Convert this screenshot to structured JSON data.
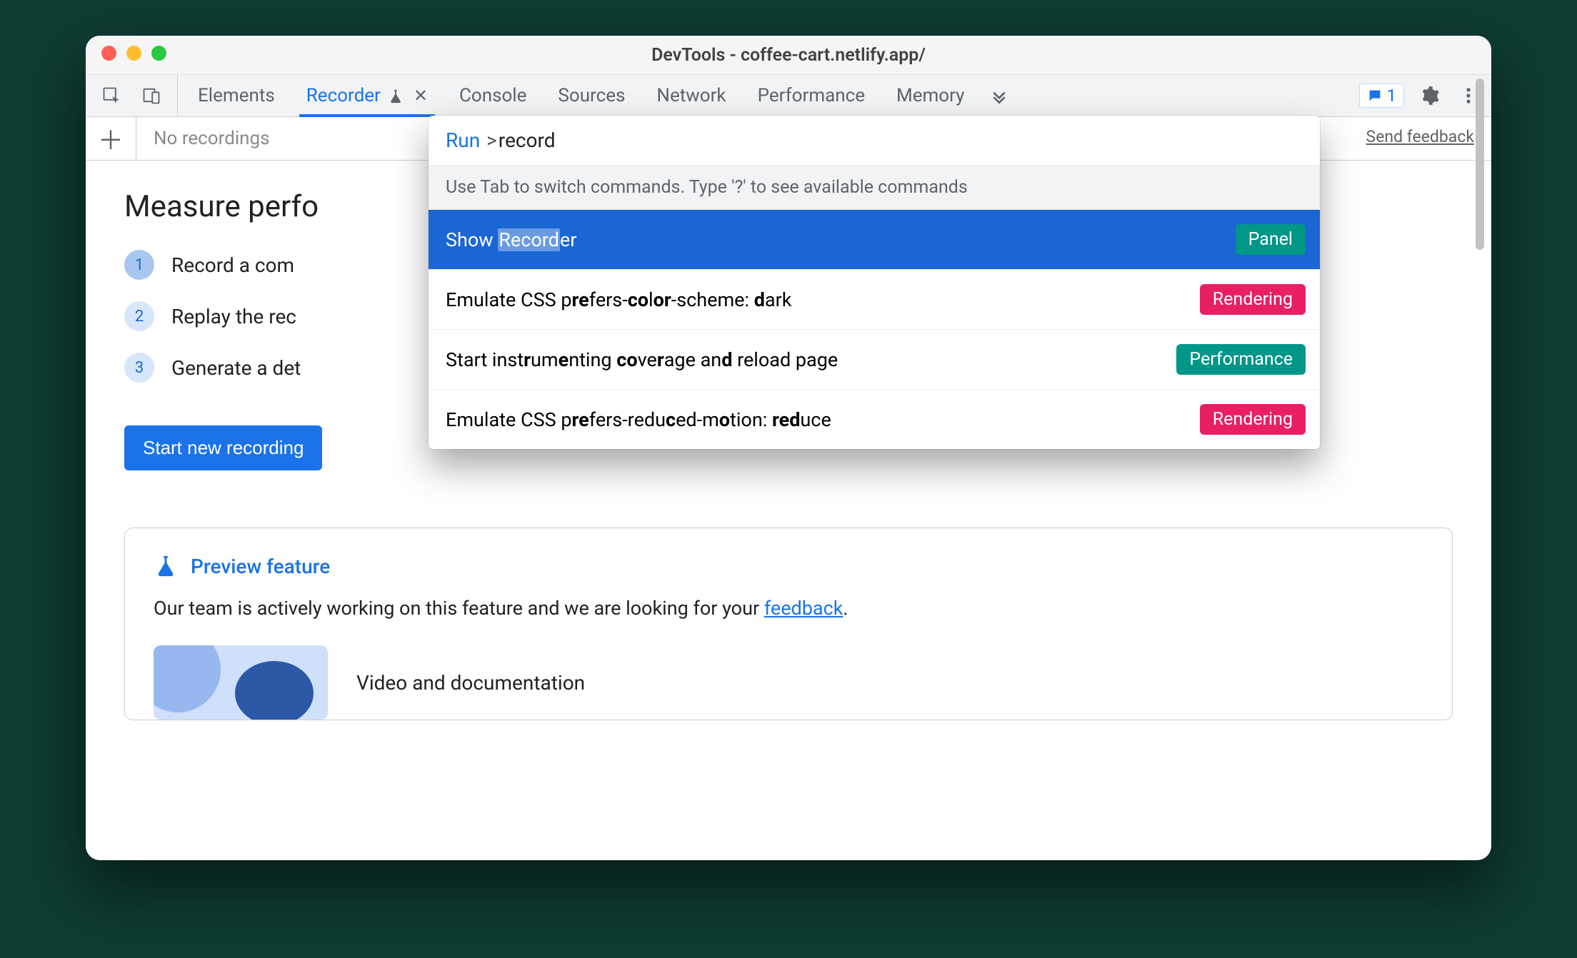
{
  "window": {
    "title": "DevTools - coffee-cart.netlify.app/"
  },
  "tabs": {
    "items": [
      "Elements",
      "Recorder",
      "Console",
      "Sources",
      "Network",
      "Performance",
      "Memory"
    ],
    "active_index": 1,
    "experiment_tab_index": 1,
    "closable_tab_index": 1,
    "issues_count": "1"
  },
  "toolbar": {
    "dropdown_placeholder": "No recordings",
    "feedback_link": "Send feedback"
  },
  "content": {
    "heading": "Measure perfo",
    "steps": [
      {
        "n": "1",
        "text": "Record a com"
      },
      {
        "n": "2",
        "text": "Replay the rec"
      },
      {
        "n": "3",
        "text": "Generate a det"
      }
    ],
    "start_button": "Start new recording",
    "preview": {
      "title": "Preview feature",
      "body_pre": "Our team is actively working on this feature and we are looking for your ",
      "body_link": "feedback",
      "body_post": ".",
      "video_title": "Video and documentation"
    }
  },
  "palette": {
    "prefix": "Run",
    "chevron": ">",
    "query": "record",
    "hint": "Use Tab to switch commands. Type '?' to see available commands",
    "rows": [
      {
        "html": "Show <span class='hl-selected'>Record</span>er",
        "tag": "Panel",
        "tag_class": "panel",
        "selected": true
      },
      {
        "html": "Emulate CSS p<span class='hl'>r</span><span class='hl'>e</span>fers-<span class='hl'>c</span><span class='hl'>o</span>l<span class='hl'>o</span><span class='hl'>r</span>-scheme: <span class='hl'>d</span>ark",
        "tag": "Rendering",
        "tag_class": "render",
        "selected": false
      },
      {
        "html": "Start inst<span class='hl'>r</span>um<span class='hl'>e</span>nting <span class='hl'>c</span><span class='hl'>o</span>ve<span class='hl'>r</span>age an<span class='hl'>d</span> reload page",
        "tag": "Performance",
        "tag_class": "perf",
        "selected": false
      },
      {
        "html": "Emulate CSS p<span class='hl'>r</span><span class='hl'>e</span>fers-redu<span class='hl'>c</span>ed-m<span class='hl'>o</span>tion: <span class='hl'>r</span><span class='hl'>e</span><span class='hl'>d</span>uce",
        "tag": "Rendering",
        "tag_class": "render",
        "selected": false
      }
    ]
  }
}
